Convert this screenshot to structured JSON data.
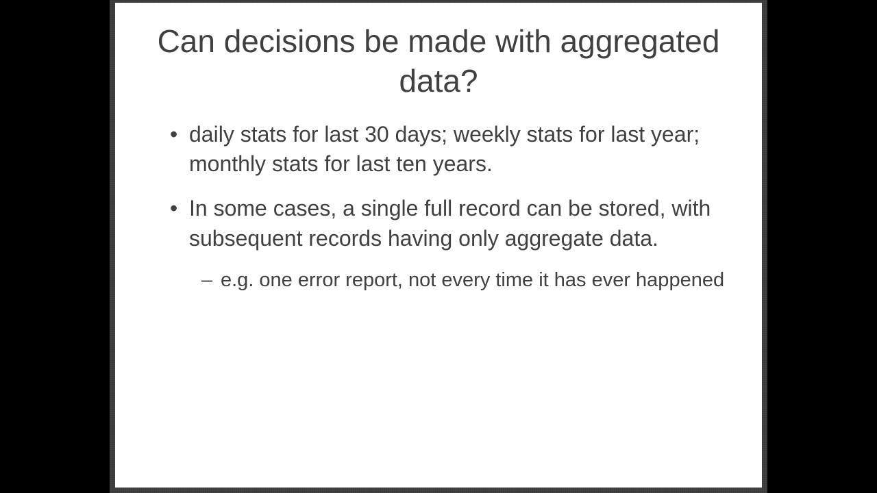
{
  "slide": {
    "title": "Can decisions be made with aggregated data?",
    "bullets": [
      {
        "text": "daily stats for last 30 days; weekly stats for last year; monthly stats for last ten years."
      },
      {
        "text": "In some cases, a single full record can be stored, with subsequent records having only aggregate data.",
        "sub": [
          "e.g. one error report, not every time it has ever happened"
        ]
      }
    ]
  }
}
